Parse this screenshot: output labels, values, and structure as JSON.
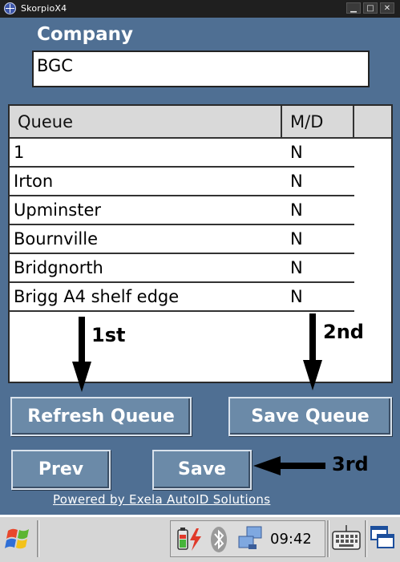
{
  "window": {
    "title": "SkorpioX4",
    "icons": [
      "app-icon",
      "minimize-icon",
      "maximize-icon",
      "close-icon"
    ]
  },
  "company": {
    "label": "Company",
    "value": "BGC"
  },
  "queue_list": {
    "headers": {
      "queue": "Queue",
      "md": "M/D"
    },
    "rows": [
      {
        "queue": "1",
        "md": "N"
      },
      {
        "queue": "Irton",
        "md": "N"
      },
      {
        "queue": "Upminster",
        "md": "N"
      },
      {
        "queue": "Bournville",
        "md": "N"
      },
      {
        "queue": "Bridgnorth",
        "md": "N"
      },
      {
        "queue": "Brigg A4 shelf edge",
        "md": "N"
      }
    ]
  },
  "buttons": {
    "refresh_queue": "Refresh Queue",
    "save_queue": "Save Queue",
    "prev": "Prev",
    "save": "Save"
  },
  "footer": {
    "powered_by": "Powered by Exela AutoID Solutions"
  },
  "annotations": {
    "first": "1st",
    "second": "2nd",
    "third": "3rd"
  },
  "taskbar": {
    "clock": "09:42",
    "icons": [
      "windows-start-icon",
      "battery-charging-icon",
      "bluetooth-icon",
      "network-icon",
      "keyboard-icon",
      "multitask-icon"
    ]
  }
}
